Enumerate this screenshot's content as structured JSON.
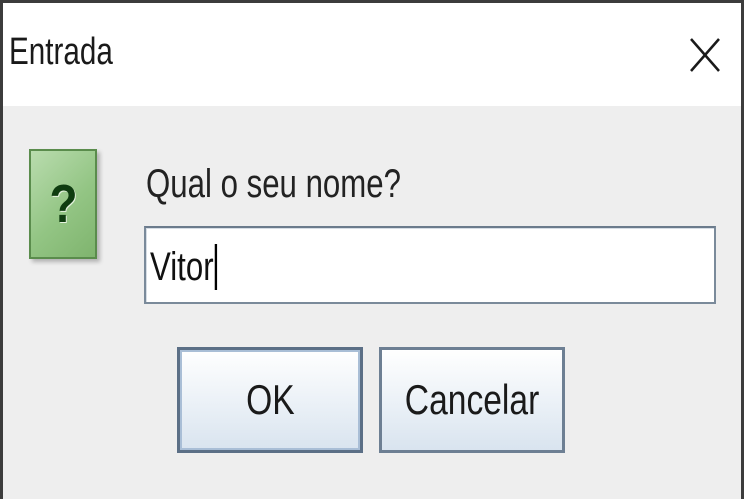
{
  "dialog": {
    "title": "Entrada",
    "close_icon": "close-icon",
    "icon": "question-icon",
    "icon_glyph": "?",
    "icon_color": "#93c584",
    "prompt": "Qual o seu nome?",
    "input": {
      "value": "Vitor",
      "placeholder": ""
    },
    "buttons": {
      "ok_label": "OK",
      "cancel_label": "Cancelar"
    }
  }
}
